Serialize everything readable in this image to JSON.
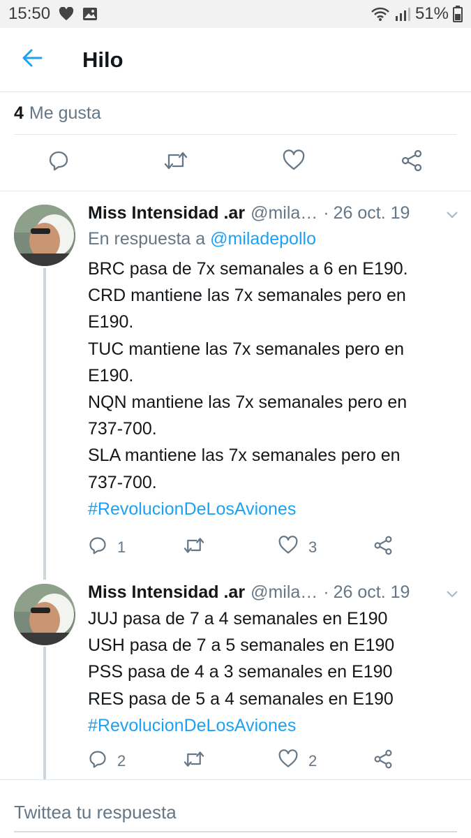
{
  "status_bar": {
    "time": "15:50",
    "battery": "51%"
  },
  "app_bar": {
    "title": "Hilo"
  },
  "likes": {
    "count": "4",
    "label": "Me gusta"
  },
  "main_actions": [
    "reply-icon",
    "retweet-icon",
    "like-icon",
    "share-icon"
  ],
  "tweets": [
    {
      "name": "Miss Intensidad .ar",
      "handle": "@mila…",
      "dot": "·",
      "date": "26 oct. 19",
      "reply_prefix": "En respuesta a",
      "reply_handle": "@miladepollo",
      "lines": [
        "BRC pasa de 7x semanales a 6 en E190.",
        "CRD mantiene las 7x semanales pero en",
        "E190.",
        "TUC mantiene las 7x semanales pero en",
        "E190.",
        "NQN mantiene las 7x semanales pero en",
        "737-700.",
        "SLA mantiene las 7x semanales pero en",
        "737-700."
      ],
      "hashtag": "#RevolucionDeLosAviones",
      "replies": "1",
      "likes": "3"
    },
    {
      "name": "Miss Intensidad .ar",
      "handle": "@mila…",
      "dot": "·",
      "date": "26 oct. 19",
      "lines": [
        "JUJ pasa de 7 a 4 semanales en E190",
        "USH pasa de 7 a 5 semanales en E190",
        "PSS pasa de 4 a 3 semanales en E190",
        "RES pasa de 5 a 4 semanales en E190"
      ],
      "hashtag": "#RevolucionDeLosAviones",
      "replies": "2",
      "likes": "2"
    }
  ],
  "reply_box": {
    "placeholder": "Twittea tu respuesta"
  },
  "colors": {
    "accent": "#1da1f2",
    "secondary_text": "#657786",
    "thread_line": "#ccd6dd"
  }
}
